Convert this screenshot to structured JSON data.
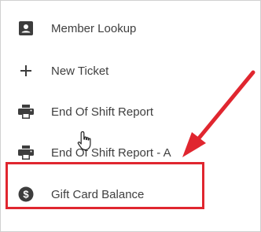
{
  "menu": {
    "items": [
      {
        "label": "Member Lookup",
        "icon": "member-card-icon"
      },
      {
        "label": "New Ticket",
        "icon": "plus-icon"
      },
      {
        "label": "End Of Shift Report",
        "icon": "printer-icon"
      },
      {
        "label": "End Of Shift Report - A",
        "icon": "printer-icon"
      },
      {
        "label": "Gift Card Balance",
        "icon": "dollar-circle-icon"
      }
    ]
  },
  "annotation": {
    "highlight_color": "#e0262f",
    "highlighted_item": "Gift Card Balance"
  },
  "colors": {
    "icon": "#3d3d3d",
    "text": "#3f3f3f"
  }
}
